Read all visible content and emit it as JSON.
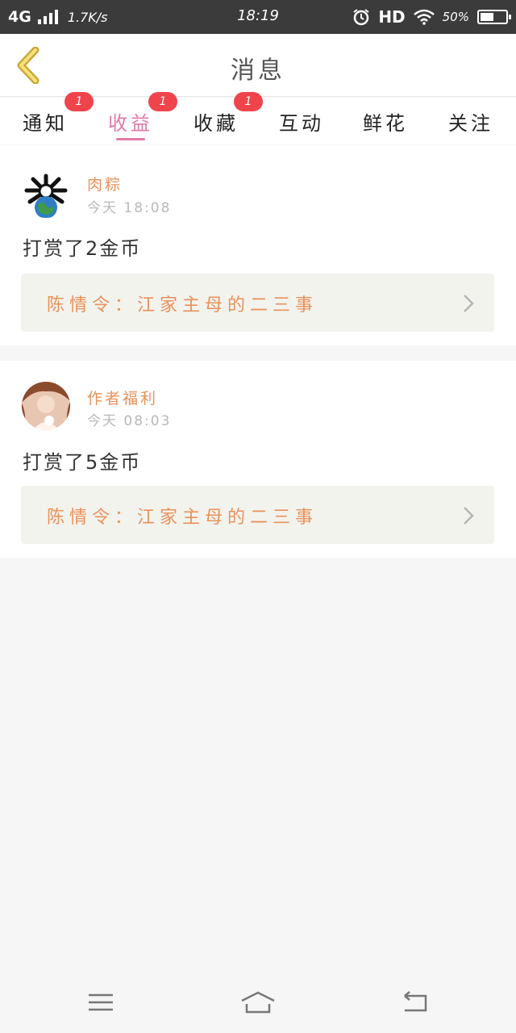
{
  "status_bar": {
    "network": "4G",
    "speed": "1.7K/s",
    "time": "18:19",
    "hd": "HD",
    "battery": "50%"
  },
  "header": {
    "title": "消息"
  },
  "tabs": [
    {
      "label": "通知",
      "badge": "1",
      "active": false
    },
    {
      "label": "收益",
      "badge": "1",
      "active": true
    },
    {
      "label": "收藏",
      "badge": "1",
      "active": false
    },
    {
      "label": "互动",
      "active": false
    },
    {
      "label": "鲜花",
      "active": false
    },
    {
      "label": "关注",
      "active": false
    }
  ],
  "messages": [
    {
      "user": "肉粽",
      "time": "今天 18:08",
      "text": "打赏了2金币",
      "book": "陈情令：江家主母的二三事"
    },
    {
      "user": "作者福利",
      "time": "今天 08:03",
      "text": "打赏了5金币",
      "book": "陈情令：江家主母的二三事"
    }
  ],
  "colors": {
    "accent_pink": "#e27aa8",
    "orange_text": "#e9915a",
    "badge_red": "#f0444d"
  }
}
